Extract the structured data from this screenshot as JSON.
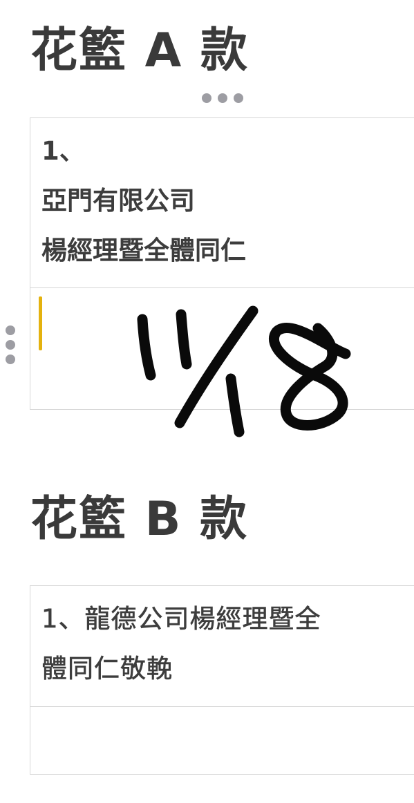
{
  "sections": [
    {
      "title": "花籃 A 款",
      "rows": [
        {
          "lines": [
            "1、",
            "亞門有限公司",
            "楊經理暨全體同仁"
          ]
        },
        {
          "lines": [
            ""
          ]
        }
      ]
    },
    {
      "title": "花籃 B 款",
      "rows": [
        {
          "lines": [
            "1、龍德公司楊經理暨全",
            "體同仁敬輓"
          ]
        },
        {
          "lines": [
            ""
          ]
        }
      ]
    }
  ],
  "handwriting": {
    "text": "11/18",
    "color": "#0a0a0a"
  },
  "colors": {
    "cursor": "#e4b20e",
    "border": "#d6d6d6",
    "handle": "#9d9da3",
    "text": "#3d3d3d"
  }
}
